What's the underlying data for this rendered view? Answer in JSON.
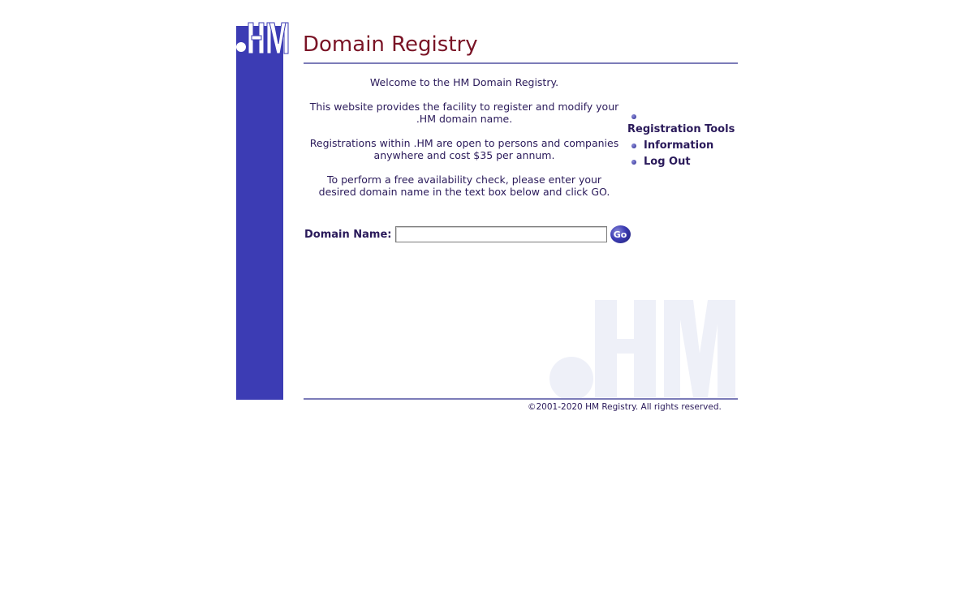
{
  "logo": {
    "text": ".HM",
    "icon": "hm-logo"
  },
  "header": {
    "title": "Domain Registry"
  },
  "intro": {
    "welcome": "Welcome to the HM Domain Registry.",
    "facility": "This website provides the facility to register and modify your .HM domain name.",
    "registrations": "Registrations within .HM are open to persons and companies anywhere and cost $35 per annum.",
    "availability": "To perform a free availability check, please enter your desired domain name in the text box below and click GO."
  },
  "search": {
    "label": "Domain Name:",
    "value": "",
    "placeholder": "",
    "button_label": "Go"
  },
  "nav": {
    "heading": "Registration Tools",
    "items": [
      {
        "label": "Information"
      },
      {
        "label": "Log Out"
      }
    ]
  },
  "watermark": {
    "text": ".HM"
  },
  "footer": {
    "copyright": "©2001-2020 HM Registry. All rights reserved."
  },
  "colors": {
    "sidebar": "#3c3cb4",
    "title": "#7a1426",
    "text": "#2a1a5a",
    "rule": "#7c7cb8",
    "watermark": "#eef0f8"
  }
}
